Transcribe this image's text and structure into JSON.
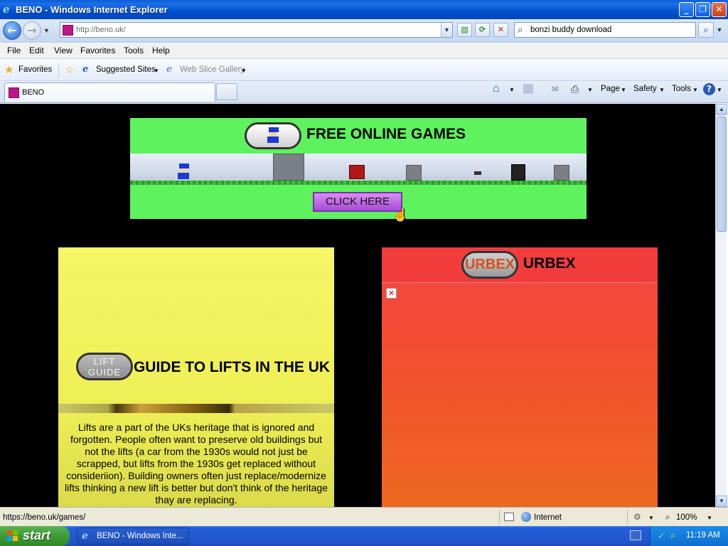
{
  "window": {
    "title": "BENO - Windows Internet Explorer",
    "buttons": [
      "minimize",
      "maximize",
      "close"
    ]
  },
  "address_bar": {
    "url": "http://beno.uk/",
    "search_value": "bonzi buddy download"
  },
  "menu": [
    "File",
    "Edit",
    "View",
    "Favorites",
    "Tools",
    "Help"
  ],
  "favorites_bar": {
    "favorites_label": "Favorites",
    "suggested_sites": "Suggested Sites",
    "web_slice_gallery": "Web Slice Gallery"
  },
  "tab": {
    "label": "BENO"
  },
  "command_bar": {
    "page": "Page",
    "safety": "Safety",
    "tools": "Tools"
  },
  "page": {
    "games_banner": {
      "heading": "FREE ONLINE GAMES",
      "button": "CLICK HERE"
    },
    "lift_card": {
      "badge": "LIFT GUIDE",
      "heading": "GUIDE TO LIFTS IN THE UK",
      "body": "Lifts are a part of the UKs heritage that is ignored and forgotten. People often want to preserve old buildings but not the lifts (a car from the 1930s would not just be scrapped, but lifts from the 1930s get replaced without consideriion). Building owners often just replace/modernize lifts thinking a new lift is better but don't think of the heritage thay are replacing."
    },
    "urbex_card": {
      "badge": "URBEX",
      "heading": "URBEX"
    }
  },
  "status_bar": {
    "url": "https://beno.uk/games/",
    "zone": "Internet",
    "zoom": "100%"
  },
  "taskbar": {
    "start": "start",
    "task": "BENO - Windows Inte...",
    "clock": "11:19 AM"
  },
  "colors": {
    "games_bg": "#5ef25e",
    "lift_bg": "#f6f666",
    "urbex_bg": "#f23c3c",
    "button_purple": "#b25ce0",
    "xp_blue": "#245edb",
    "start_green": "#3c9a34"
  }
}
